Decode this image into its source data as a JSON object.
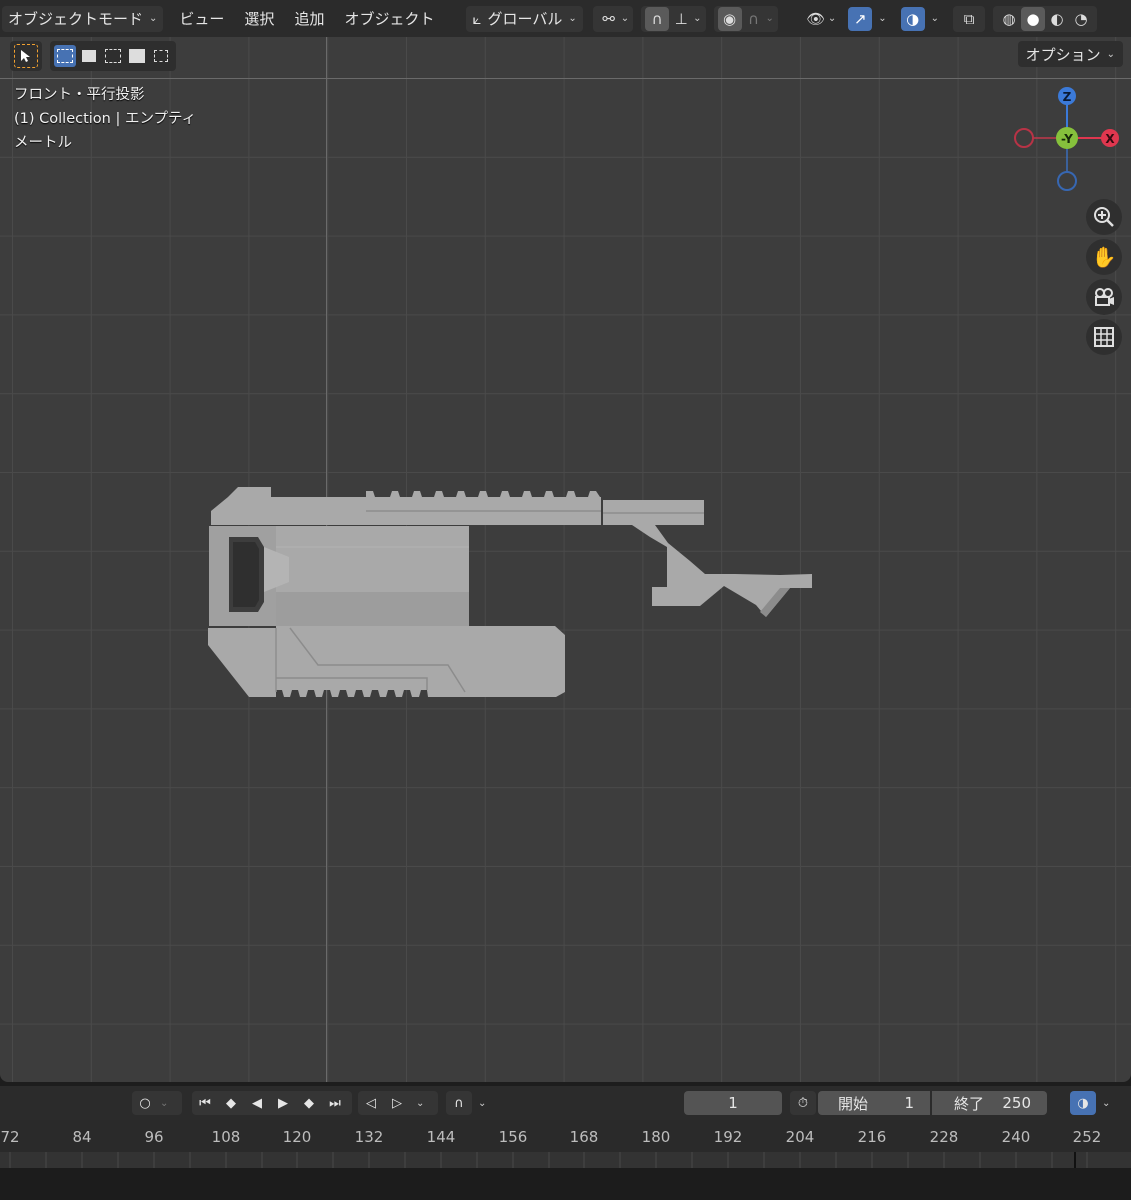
{
  "header": {
    "mode": "オブジェクトモード",
    "menus": [
      "ビュー",
      "選択",
      "追加",
      "オブジェクト"
    ],
    "transform_orientation": "グローバル"
  },
  "viewport": {
    "options": "オプション",
    "info": [
      "フロント・平行投影",
      "(1) Collection | エンプティ",
      "メートル"
    ],
    "gizmo": {
      "z": "Z",
      "y": "-Y",
      "x": "X"
    },
    "nav_icons": [
      "zoom-icon",
      "hand-pan-icon",
      "camera-icon",
      "grid-icon"
    ]
  },
  "timeline": {
    "current_frame": "1",
    "start_label": "開始",
    "start_value": "1",
    "end_label": "終了",
    "end_value": "250",
    "ruler": [
      "72",
      "84",
      "96",
      "108",
      "120",
      "132",
      "144",
      "156",
      "168",
      "180",
      "192",
      "204",
      "216",
      "228",
      "240",
      "252"
    ]
  },
  "colors": {
    "accent": "#4772b3",
    "axis_x": "#e0374f",
    "axis_y": "#86c13c",
    "axis_z": "#3b7ad9",
    "selection": "#f0a030",
    "model": "#a7a7a7"
  }
}
